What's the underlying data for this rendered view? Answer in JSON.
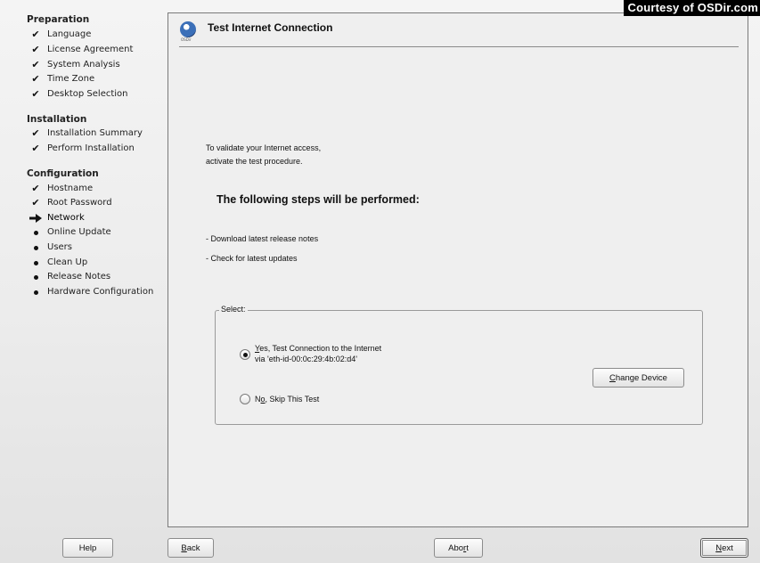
{
  "watermark": "Courtesy of OSDir.com",
  "sidebar": {
    "sections": [
      {
        "title": "Preparation",
        "steps": [
          {
            "label": "Language",
            "status": "done"
          },
          {
            "label": "License Agreement",
            "status": "done"
          },
          {
            "label": "System Analysis",
            "status": "done"
          },
          {
            "label": "Time Zone",
            "status": "done"
          },
          {
            "label": "Desktop Selection",
            "status": "done"
          }
        ]
      },
      {
        "title": "Installation",
        "steps": [
          {
            "label": "Installation Summary",
            "status": "done"
          },
          {
            "label": "Perform Installation",
            "status": "done"
          }
        ]
      },
      {
        "title": "Configuration",
        "steps": [
          {
            "label": "Hostname",
            "status": "done"
          },
          {
            "label": "Root Password",
            "status": "done"
          },
          {
            "label": "Network",
            "status": "current"
          },
          {
            "label": "Online Update",
            "status": "pending"
          },
          {
            "label": "Users",
            "status": "pending"
          },
          {
            "label": "Clean Up",
            "status": "pending"
          },
          {
            "label": "Release Notes",
            "status": "pending"
          },
          {
            "label": "Hardware Configuration",
            "status": "pending"
          }
        ]
      }
    ]
  },
  "header": {
    "title": "Test Internet Connection",
    "icon": "globe-icon",
    "icon_caption": "OSDir"
  },
  "content": {
    "intro_line1": "To validate your Internet access,",
    "intro_line2": "activate the test procedure.",
    "steps_heading": "The following steps will be performed:",
    "step_items": [
      "- Download latest release notes",
      "- Check for latest updates"
    ]
  },
  "select_group": {
    "legend": "Select:",
    "option_yes": {
      "mnemonic": "Y",
      "rest": "es, Test Connection to the Internet",
      "detail": "via 'eth-id-00:0c:29:4b:02:d4'",
      "selected": true
    },
    "option_no": {
      "pre": "N",
      "mnemonic": "o",
      "rest": ", Skip This Test",
      "selected": false
    },
    "change_device": {
      "mnemonic": "C",
      "rest": "hange Device"
    }
  },
  "buttons": {
    "help": "Help",
    "back": {
      "mnemonic": "B",
      "rest": "ack"
    },
    "abort": {
      "pre": "Abo",
      "mnemonic": "r",
      "rest": "t"
    },
    "next": {
      "mnemonic": "N",
      "rest": "ext"
    }
  },
  "colors": {
    "panel_bg": "#efefef",
    "sidebar_bg": "#ececec"
  }
}
